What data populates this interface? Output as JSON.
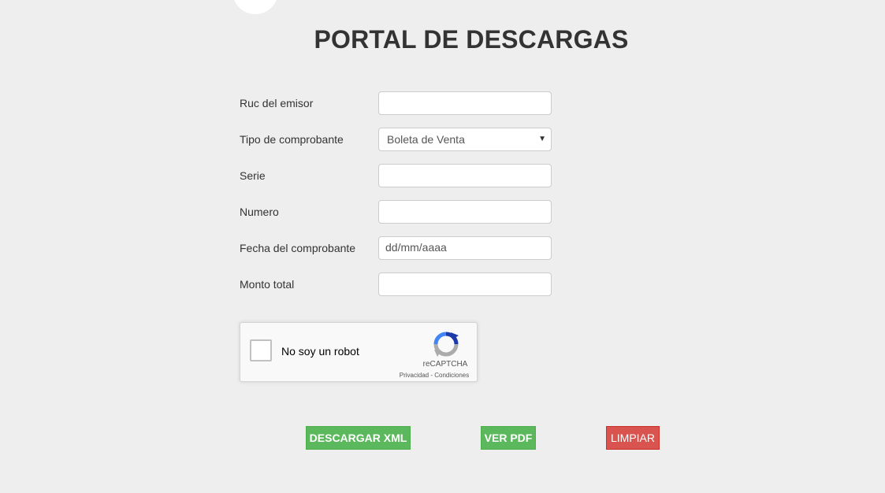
{
  "header": {
    "title": "PORTAL DE DESCARGAS"
  },
  "form": {
    "ruc": {
      "label": "Ruc del emisor",
      "value": ""
    },
    "tipo": {
      "label": "Tipo de comprobante",
      "selected": "Boleta de Venta"
    },
    "serie": {
      "label": "Serie",
      "value": ""
    },
    "numero": {
      "label": "Numero",
      "value": ""
    },
    "fecha": {
      "label": "Fecha del comprobante",
      "placeholder": "dd/mm/aaaa"
    },
    "monto": {
      "label": "Monto total",
      "value": ""
    }
  },
  "captcha": {
    "label": "No soy un robot",
    "brand": "reCAPTCHA",
    "links": "Privacidad - Condiciones",
    "colors": {
      "blue_dark": "#1c3aa9",
      "blue_light": "#4285f4",
      "gray": "#ababab"
    }
  },
  "actions": {
    "download_xml": "DESCARGAR XML",
    "view_pdf": "VER PDF",
    "clear": "LIMPIAR"
  },
  "colors": {
    "background": "#eeeeee",
    "success": "#5cb85c",
    "danger": "#d9534f"
  }
}
